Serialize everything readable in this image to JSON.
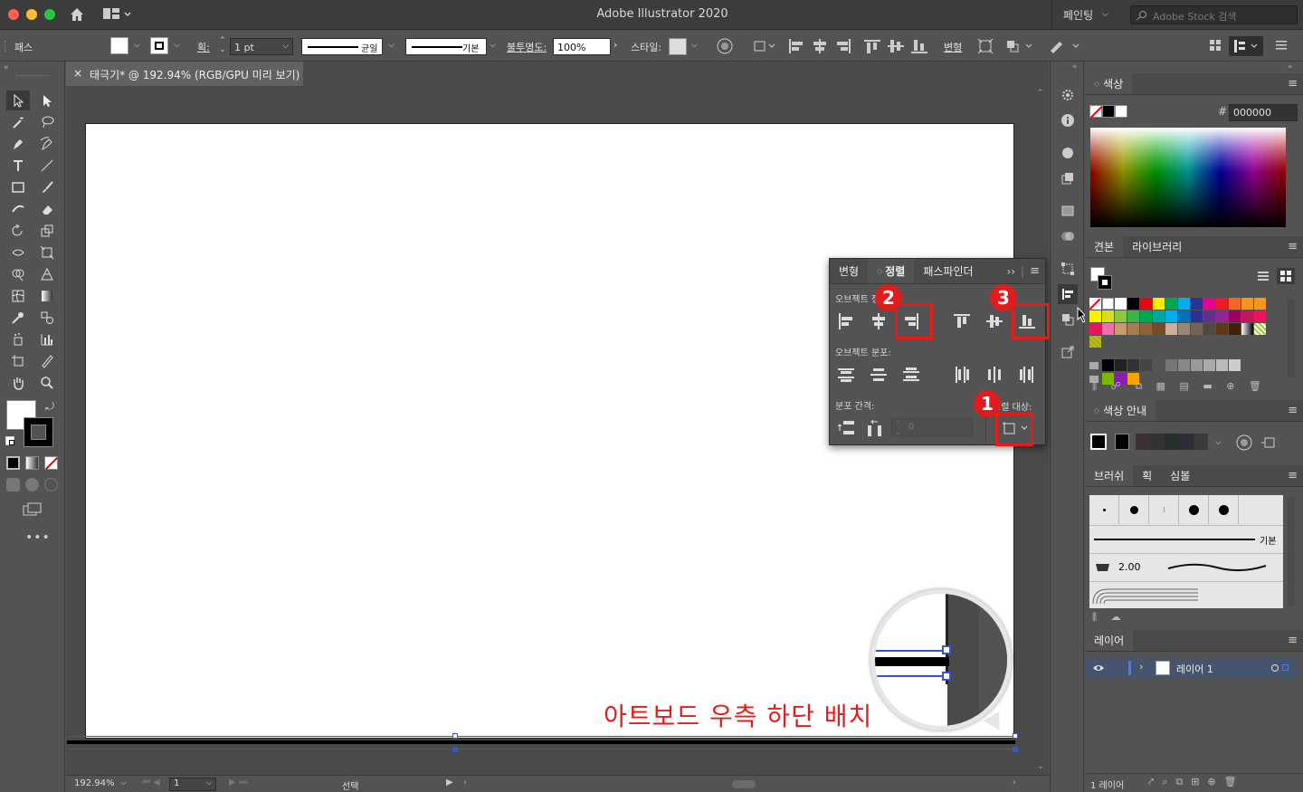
{
  "app": {
    "title": "Adobe Illustrator 2020",
    "workspace": "페인팅",
    "stock_search_placeholder": "Adobe Stock 검색"
  },
  "control_bar": {
    "selection_type": "패스",
    "stroke_label": "획:",
    "stroke_weight": "1 pt",
    "profile_uniform": "균일",
    "brush_basic": "기본",
    "opacity_label": "불투명도:",
    "opacity_value": "100%",
    "style_label": "스타일:",
    "transform_label": "변형"
  },
  "document_tab": {
    "close": "×",
    "title": "태극기* @ 192.94% (RGB/GPU 미리 보기)"
  },
  "align_panel": {
    "tabs": [
      "변형",
      "정렬",
      "패스파인더"
    ],
    "active_tab": "정렬",
    "section_align_objects": "오브젝트 정렬:",
    "section_distribute_objects": "오브젝트 분포:",
    "section_distribute_spacing": "분포 간격:",
    "align_to_label": "정렬 대상:",
    "spacing_value": "0"
  },
  "annotations": {
    "badge1": "1",
    "badge2": "2",
    "badge3": "3",
    "caption": "아트보드 우측 하단 배치",
    "color": "#e51c1c"
  },
  "color_panel": {
    "title": "색상",
    "hex_label": "#",
    "hex_value": "000000"
  },
  "swatches_panel": {
    "tabs": [
      "견본",
      "라이브러리"
    ]
  },
  "color_guide_panel": {
    "title": "색상 안내"
  },
  "brush_panel": {
    "tabs": [
      "브러쉬",
      "획",
      "심볼"
    ],
    "basic_label": "기본",
    "brush_size": "2.00"
  },
  "layers_panel": {
    "title": "레이어",
    "layer_name": "레이어 1",
    "footer_count": "1 레이어"
  },
  "status_bar": {
    "zoom": "192.94%",
    "artboard_number": "1",
    "tool_status": "선택"
  }
}
